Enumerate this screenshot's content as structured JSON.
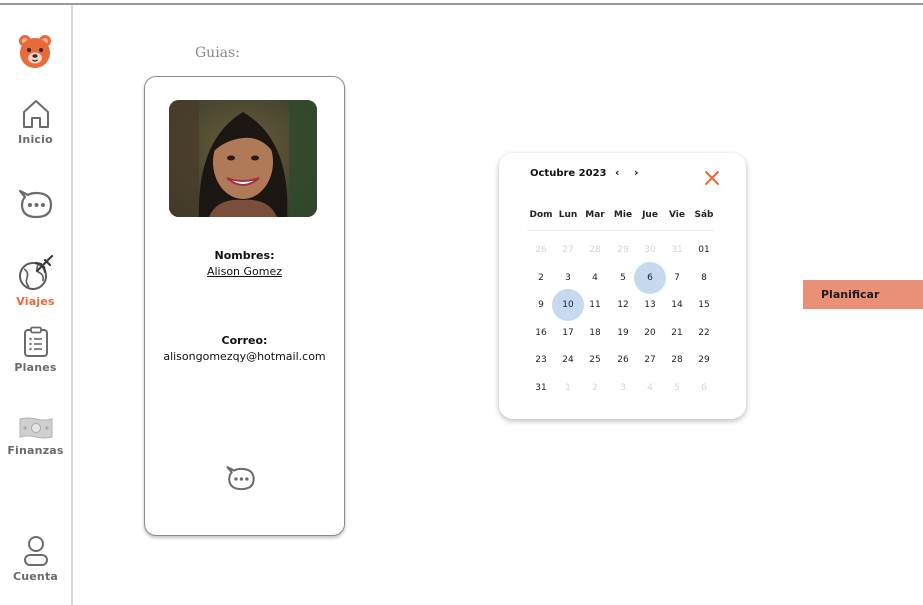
{
  "sidebar": {
    "items": [
      {
        "id": "inicio",
        "label": "Inicio",
        "icon": "home-icon"
      },
      {
        "id": "chat",
        "label": "",
        "icon": "chat-icon"
      },
      {
        "id": "viajes",
        "label": "Viajes",
        "icon": "globe-plane-icon",
        "active": true
      },
      {
        "id": "planes",
        "label": "Planes",
        "icon": "clipboard-icon"
      },
      {
        "id": "finanzas",
        "label": "Finanzas",
        "icon": "money-icon"
      },
      {
        "id": "cuenta",
        "label": "Cuenta",
        "icon": "user-icon"
      }
    ]
  },
  "main": {
    "section_title": "Guias:"
  },
  "guide": {
    "name_label": "Nombres:",
    "name": "Alison Gomez",
    "email_label": "Correo:",
    "email": "alisongomezqy@hotmail.com"
  },
  "calendar": {
    "month": "Octubre 2023",
    "prev": "‹",
    "next": "›",
    "weekdays": [
      "Dom",
      "Lun",
      "Mar",
      "Mie",
      "Jue",
      "Vie",
      "Sáb"
    ],
    "weeks": [
      [
        "26",
        "27",
        "28",
        "29",
        "30",
        "31",
        "01"
      ],
      [
        "2",
        "3",
        "4",
        "5",
        "6",
        "7",
        "8"
      ],
      [
        "9",
        "10",
        "11",
        "12",
        "13",
        "14",
        "15"
      ],
      [
        "16",
        "17",
        "18",
        "19",
        "20",
        "21",
        "22"
      ],
      [
        "23",
        "24",
        "25",
        "26",
        "27",
        "28",
        "29"
      ],
      [
        "31",
        "1",
        "2",
        "3",
        "4",
        "5",
        "6"
      ]
    ],
    "muted": [
      [
        0,
        0
      ],
      [
        0,
        1
      ],
      [
        0,
        2
      ],
      [
        0,
        3
      ],
      [
        0,
        4
      ],
      [
        0,
        5
      ],
      [
        5,
        1
      ],
      [
        5,
        2
      ],
      [
        5,
        3
      ],
      [
        5,
        4
      ],
      [
        5,
        5
      ],
      [
        5,
        6
      ]
    ],
    "highlighted": [
      [
        1,
        4
      ],
      [
        2,
        1
      ]
    ]
  },
  "actions": {
    "plan_label": "Planificar"
  },
  "colors": {
    "accent": "#e8693a",
    "button": "#e99076",
    "highlight": "#c6d9ee"
  }
}
